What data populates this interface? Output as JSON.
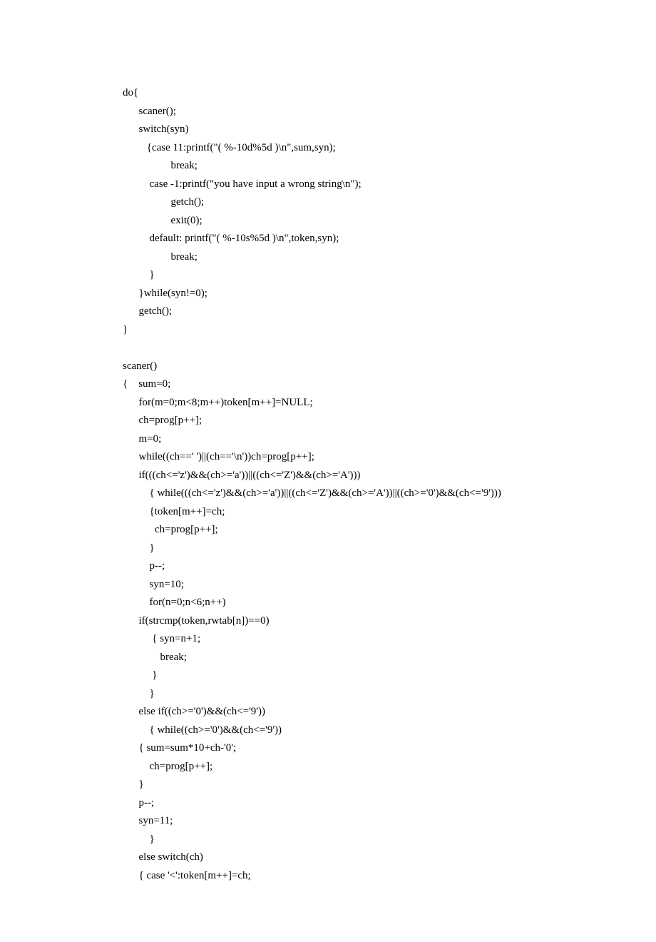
{
  "lines": [
    "do{",
    "      scaner();",
    "      switch(syn)",
    "         {case 11:printf(\"( %-10d%5d )\\n\",sum,syn);",
    "                  break;",
    "          case -1:printf(\"you have input a wrong string\\n\");",
    "                  getch();",
    "                  exit(0);",
    "          default: printf(\"( %-10s%5d )\\n\",token,syn);",
    "                  break;",
    "          }",
    "      }while(syn!=0);",
    "      getch();",
    "}",
    "",
    "scaner()",
    "{    sum=0;",
    "      for(m=0;m<8;m++)token[m++]=NULL;",
    "      ch=prog[p++];",
    "      m=0;",
    "      while((ch==' ')||(ch=='\\n'))ch=prog[p++];",
    "      if(((ch<='z')&&(ch>='a'))||((ch<='Z')&&(ch>='A')))",
    "          { while(((ch<='z')&&(ch>='a'))||((ch<='Z')&&(ch>='A'))||((ch>='0')&&(ch<='9')))",
    "          {token[m++]=ch;",
    "            ch=prog[p++];",
    "          }",
    "          p--;",
    "          syn=10;",
    "          for(n=0;n<6;n++)",
    "      if(strcmp(token,rwtab[n])==0)",
    "           { syn=n+1;",
    "              break;",
    "           }",
    "          }",
    "      else if((ch>='0')&&(ch<='9'))",
    "          { while((ch>='0')&&(ch<='9'))",
    "      { sum=sum*10+ch-'0';",
    "          ch=prog[p++];",
    "      }",
    "      p--;",
    "      syn=11;",
    "          }",
    "      else switch(ch)",
    "      { case '<':token[m++]=ch;"
  ]
}
